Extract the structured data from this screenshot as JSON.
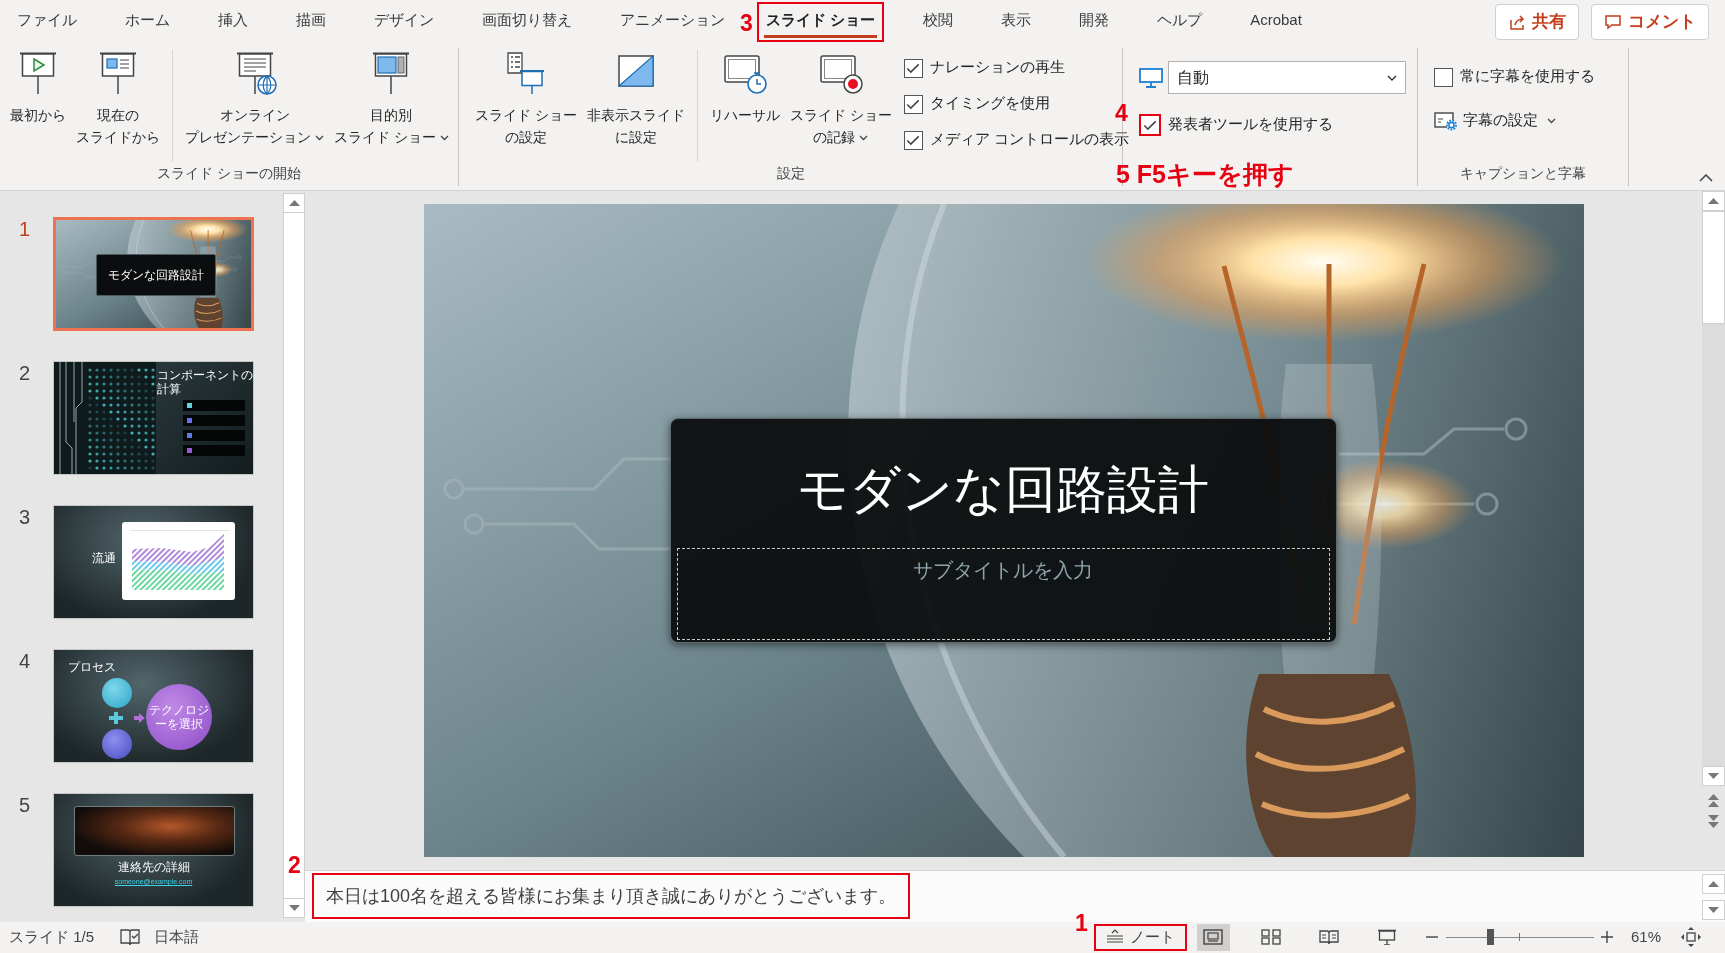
{
  "ribbon_tabs": [
    {
      "label": "ファイル",
      "selected": false
    },
    {
      "label": "ホーム",
      "selected": false
    },
    {
      "label": "挿入",
      "selected": false
    },
    {
      "label": "描画",
      "selected": false
    },
    {
      "label": "デザイン",
      "selected": false
    },
    {
      "label": "画面切り替え",
      "selected": false
    },
    {
      "label": "アニメーション",
      "selected": false
    },
    {
      "label": "スライド ショー",
      "selected": true,
      "callout": "3"
    },
    {
      "label": "校閲",
      "selected": false
    },
    {
      "label": "表示",
      "selected": false
    },
    {
      "label": "開発",
      "selected": false
    },
    {
      "label": "ヘルプ",
      "selected": false
    },
    {
      "label": "Acrobat",
      "selected": false
    }
  ],
  "header_buttons": [
    {
      "label": "共有"
    },
    {
      "label": "コメント"
    }
  ],
  "ribbon": {
    "start_group": {
      "label": "スライド ショーの開始",
      "button_sets": [
        [
          {
            "lines": [
              "最初から"
            ],
            "dropdown": false
          },
          {
            "lines": [
              "現在の",
              "スライドから"
            ],
            "dropdown": false
          }
        ],
        [
          {
            "lines": [
              "オンライン",
              "プレゼンテーション"
            ],
            "dropdown": true
          },
          {
            "lines": [
              "目的別",
              "スライド ショー"
            ],
            "dropdown": true
          }
        ]
      ]
    },
    "setup_group": {
      "label": "設定",
      "button_sets": [
        [
          {
            "lines": [
              "スライド ショー",
              "の設定"
            ],
            "dropdown": false
          },
          {
            "lines": [
              "非表示スライド",
              "に設定"
            ],
            "dropdown": false
          }
        ],
        [
          {
            "lines": [
              "リハーサル"
            ],
            "dropdown": false
          },
          {
            "lines": [
              "スライド ショー",
              "の記録"
            ],
            "dropdown": true
          }
        ]
      ],
      "checkboxes": [
        {
          "label": "ナレーションの再生",
          "checked": true
        },
        {
          "label": "タイミングを使用",
          "checked": true
        },
        {
          "label": "メディア コントロールの表示",
          "checked": true
        }
      ]
    },
    "monitor_group": {
      "monitor": {
        "value": "自動"
      },
      "presenter_view": {
        "label": "発表者ツールを使用する",
        "checked": true,
        "callout": "4"
      },
      "instruction": "5 F5キーを押す"
    },
    "captions_group": {
      "label": "キャプションと字幕",
      "always_subtitles": {
        "label": "常に字幕を使用する",
        "checked": false
      },
      "subtitle_settings": {
        "label": "字幕の設定",
        "dropdown": true
      }
    }
  },
  "slides": [
    {
      "number": "1",
      "selected": true,
      "kind": "title",
      "title": "モダンな回路設計"
    },
    {
      "number": "2",
      "selected": false,
      "kind": "list",
      "title": "コンポーネントの計算"
    },
    {
      "number": "3",
      "selected": false,
      "kind": "chart",
      "title": "流通"
    },
    {
      "number": "4",
      "selected": false,
      "kind": "process",
      "title": "プロセス",
      "circle_text": "テクノロジーを選択"
    },
    {
      "number": "5",
      "selected": false,
      "kind": "contact",
      "title": "連絡先の詳細",
      "link": "someone@example.com"
    }
  ],
  "slide": {
    "title": "モダンな回路設計",
    "subtitle": {
      "placeholder": "サブタイトルを入力"
    }
  },
  "notes": {
    "text": "本日は100名を超える皆様にお集まり頂き誠にありがとうございます。",
    "callout": "2"
  },
  "status_bar": {
    "slide_indicator": "スライド 1/5",
    "language": "日本語",
    "notes_button": {
      "label": "ノート",
      "callout": "1"
    },
    "views": [
      {
        "selected": true
      },
      {
        "selected": false
      },
      {
        "selected": false
      },
      {
        "selected": false
      }
    ],
    "zoom": {
      "level": 0.3,
      "reading": "61%"
    }
  }
}
